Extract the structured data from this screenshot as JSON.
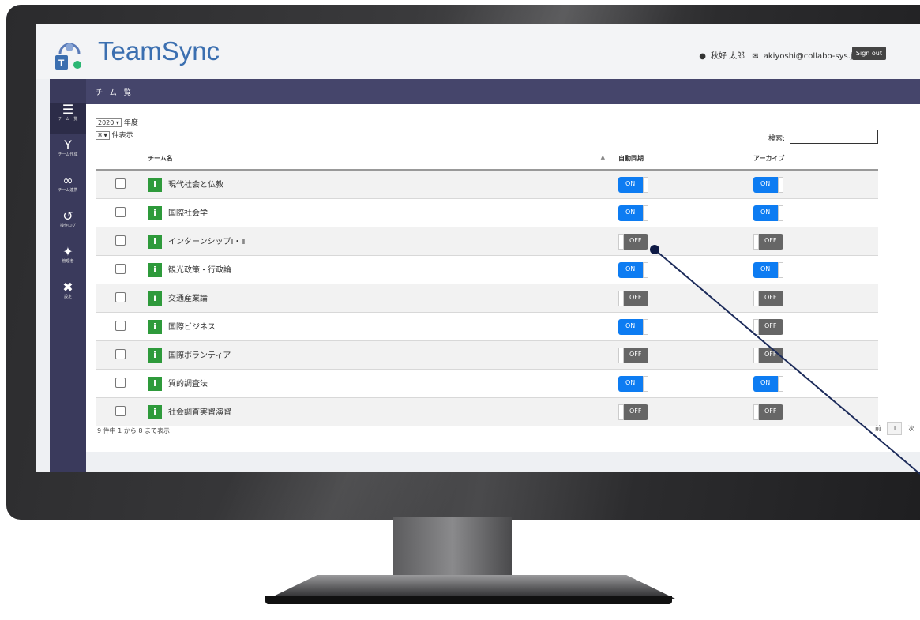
{
  "app": {
    "title": "TeamSync",
    "accent": "#3b6fb0"
  },
  "user": {
    "name": "秋好 太郎",
    "email": "akiyoshi@collabo-sys.jp",
    "signout_label": "Sign out"
  },
  "sidebar": {
    "items": [
      {
        "label": "チーム一覧",
        "icon": "team-list-icon"
      },
      {
        "label": "チーム作成",
        "icon": "sprout-icon"
      },
      {
        "label": "チーム連携",
        "icon": "link-icon"
      },
      {
        "label": "操作ログ",
        "icon": "history-icon"
      },
      {
        "label": "管理者",
        "icon": "admins-icon"
      },
      {
        "label": "設定",
        "icon": "tools-icon"
      }
    ]
  },
  "page": {
    "title": "チーム一覧"
  },
  "filters": {
    "year_value": "2020",
    "year_suffix": "年度",
    "count_value": "8",
    "count_suffix": "件表示",
    "search_label": "検索:"
  },
  "table": {
    "headers": {
      "name": "チーム名",
      "sync": "自動同期",
      "archive": "アーカイブ"
    },
    "rows": [
      {
        "name": "現代社会と仏教",
        "sync": "ON",
        "archive": "ON"
      },
      {
        "name": "国際社会学",
        "sync": "ON",
        "archive": "ON"
      },
      {
        "name": "インターンシップⅠ・Ⅱ",
        "sync": "OFF",
        "archive": "OFF"
      },
      {
        "name": "観光政策・行政論",
        "sync": "ON",
        "archive": "ON"
      },
      {
        "name": "交通産業論",
        "sync": "OFF",
        "archive": "OFF"
      },
      {
        "name": "国際ビジネス",
        "sync": "ON",
        "archive": "OFF"
      },
      {
        "name": "国際ボランティア",
        "sync": "OFF",
        "archive": "OFF"
      },
      {
        "name": "質的調査法",
        "sync": "ON",
        "archive": "ON"
      },
      {
        "name": "社会調査実習演習",
        "sync": "OFF",
        "archive": "OFF"
      }
    ]
  },
  "footer": {
    "summary": "9 件中 1 から 8 まで表示",
    "prev_label": "前",
    "page": "1",
    "next_label": "次"
  }
}
